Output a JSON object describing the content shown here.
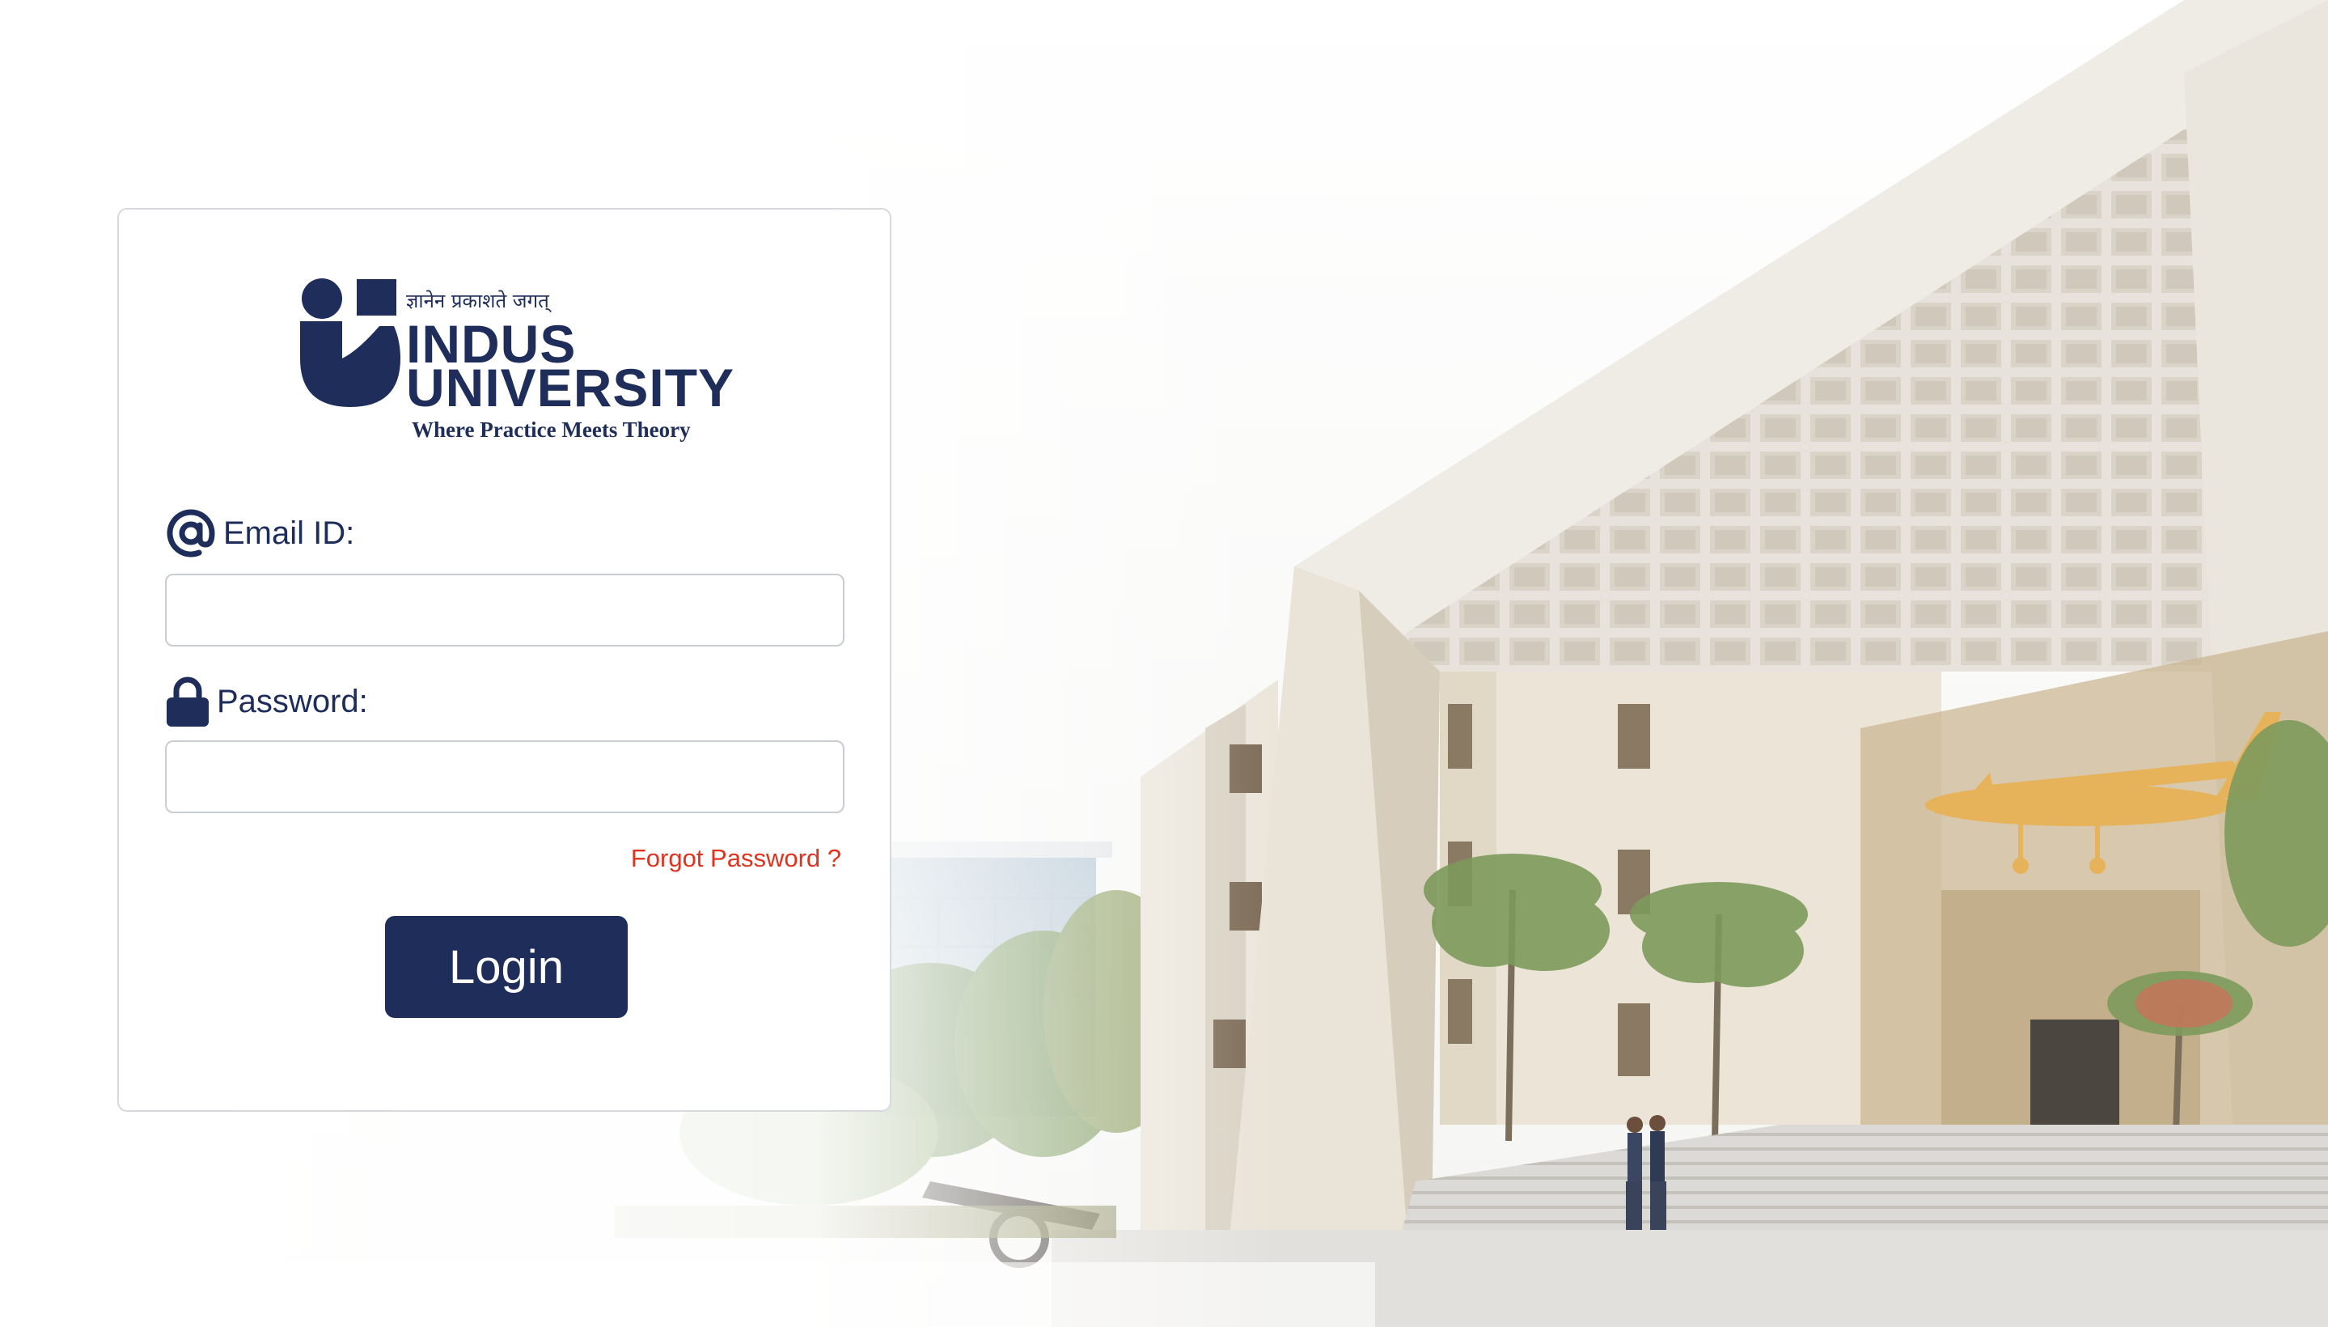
{
  "brand": {
    "tagline_hindi": "ज्ञानेन प्रकाशते जगत्",
    "name_line1": "INDUS",
    "name_line2": "UNIVERSITY",
    "slogan": "Where Practice Meets Theory",
    "color": "#1e2d5a"
  },
  "form": {
    "email_label": "Email ID:",
    "email_value": "",
    "password_label": "Password:",
    "password_value": "",
    "forgot_password": "Forgot Password ?",
    "login_label": "Login"
  },
  "icons": {
    "email": "at-sign-icon",
    "password": "lock-icon"
  },
  "colors": {
    "primary": "#1e2d5a",
    "link": "#e0331f",
    "border": "#d7d9de"
  }
}
